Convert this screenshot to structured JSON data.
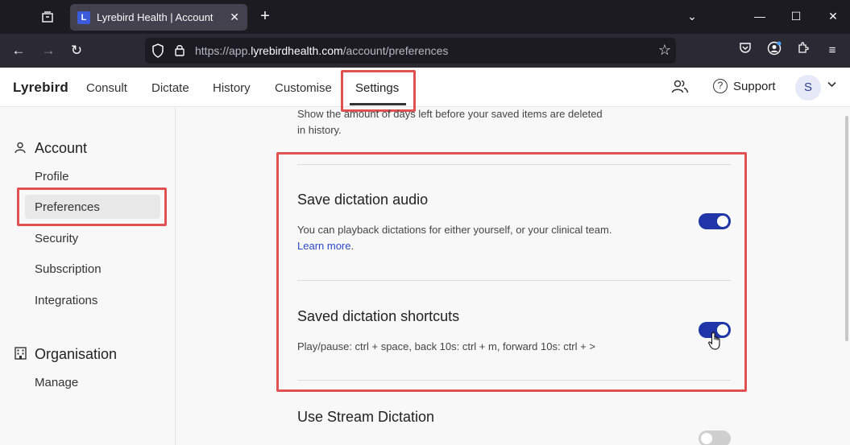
{
  "browser": {
    "tab_title": "Lyrebird Health | Account",
    "favicon_letter": "L",
    "url_prefix": "https://app.",
    "url_host": "lyrebirdhealth.com",
    "url_path": "/account/preferences"
  },
  "app": {
    "brand": "Lyrebird",
    "nav": {
      "consult": "Consult",
      "dictate": "Dictate",
      "history": "History",
      "customise": "Customise",
      "settings": "Settings"
    },
    "support_label": "Support",
    "avatar_initial": "S"
  },
  "sidebar": {
    "account_heading": "Account",
    "account_items": [
      "Profile",
      "Preferences",
      "Security",
      "Subscription",
      "Integrations"
    ],
    "org_heading": "Organisation",
    "org_items": [
      "Manage"
    ]
  },
  "content": {
    "top_desc": "Show the amount of days left before your saved items are deleted in history.",
    "audio": {
      "title": "Save dictation audio",
      "desc": "You can playback dictations for either yourself, or your clinical team.",
      "link": "Learn more",
      "enabled": true
    },
    "shortcuts": {
      "title": "Saved dictation shortcuts",
      "desc": "Play/pause: ctrl + space, back 10s: ctrl + m, forward 10s: ctrl + >",
      "enabled": true
    },
    "stream": {
      "title": "Use Stream Dictation",
      "enabled": false
    }
  },
  "colors": {
    "accent": "#1f35a8",
    "highlight": "#e05252"
  }
}
